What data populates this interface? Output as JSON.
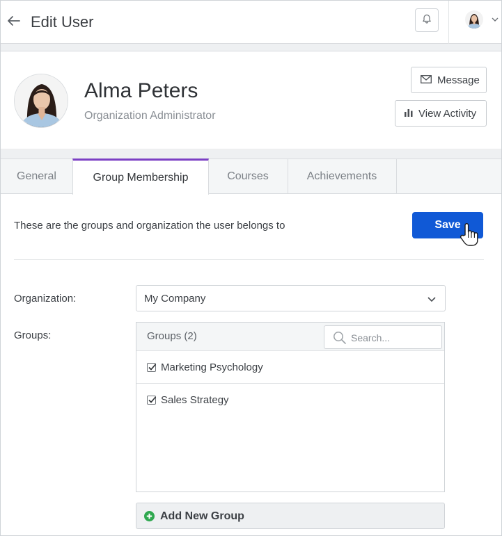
{
  "header": {
    "title": "Edit User"
  },
  "profile": {
    "name": "Alma Peters",
    "role": "Organization Administrator",
    "message_label": "Message",
    "activity_label": "View Activity"
  },
  "tabs": [
    {
      "label": "General",
      "active": false
    },
    {
      "label": "Group Membership",
      "active": true
    },
    {
      "label": "Courses",
      "active": false
    },
    {
      "label": "Achievements",
      "active": false
    }
  ],
  "content": {
    "intro": "These are the groups and organization the user belongs to",
    "save_label": "Save",
    "organization_label": "Organization:",
    "organization_value": "My Company",
    "groups_label": "Groups:",
    "groups_title": "Groups (2)",
    "search_placeholder": "Search...",
    "groups": [
      {
        "label": "Marketing Psychology",
        "checked": true
      },
      {
        "label": "Sales Strategy",
        "checked": true
      }
    ],
    "add_group_label": "Add New Group"
  },
  "colors": {
    "primary": "#1059d6",
    "tab_accent": "#7b3fc4",
    "add_icon": "#2fa84f"
  }
}
